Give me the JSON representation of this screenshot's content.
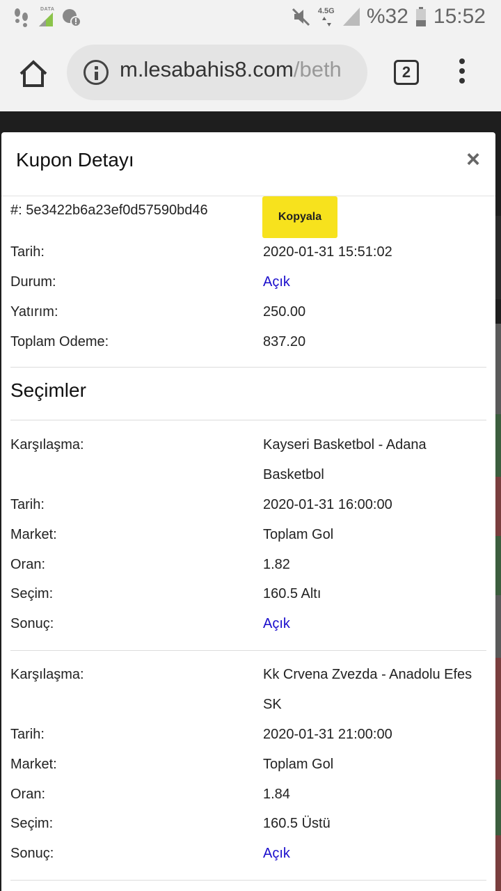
{
  "status_bar": {
    "data_label": "DATA",
    "network": "4.5G",
    "battery": "%32",
    "time": "15:52"
  },
  "browser": {
    "url_domain": "m.lesabahis8.com",
    "url_path": "/beth",
    "tab_count": "2"
  },
  "modal": {
    "title": "Kupon Detayı",
    "close": "×",
    "coupon": {
      "id_text": "#: 5e3422b6a23ef0d57590bd46",
      "copy_label": "Kopyala",
      "date_label": "Tarih:",
      "date_value": "2020-01-31 15:51:02",
      "status_label": "Durum:",
      "status_value": "Açık",
      "stake_label": "Yatırım:",
      "stake_value": "250.00",
      "payout_label": "Toplam Odeme:",
      "payout_value": "837.20"
    },
    "selections_title": "Seçimler",
    "selections": [
      {
        "match_label": "Karşılaşma:",
        "match_line1": "Kayseri Basketbol - Adana",
        "match_line2": "Basketbol",
        "date_label": "Tarih:",
        "date_value": "2020-01-31 16:00:00",
        "market_label": "Market:",
        "market_value": "Toplam Gol",
        "odds_label": "Oran:",
        "odds_value": "1.82",
        "pick_label": "Seçim:",
        "pick_value": "160.5 Altı",
        "result_label": "Sonuç:",
        "result_value": "Açık"
      },
      {
        "match_label": "Karşılaşma:",
        "match_line1": "Kk Crvena Zvezda - Anadolu Efes",
        "match_line2": "SK",
        "date_label": "Tarih:",
        "date_value": "2020-01-31 21:00:00",
        "market_label": "Market:",
        "market_value": "Toplam Gol",
        "odds_label": "Oran:",
        "odds_value": "1.84",
        "pick_label": "Seçim:",
        "pick_value": "160.5 Üstü",
        "result_label": "Sonuç:",
        "result_value": "Açık"
      }
    ]
  },
  "colors": {
    "link_blue": "#1a0dcc",
    "copy_button": "#f7e21d"
  }
}
